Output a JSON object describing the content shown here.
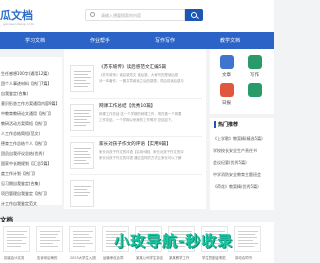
{
  "header": {
    "logo": "瓜文档",
    "logo_sub": "ganwendang.com",
    "search_placeholder": "请输入想要搜索的内容"
  },
  "nav": {
    "items": [
      "学习文档",
      "作业帮手",
      "写作写作",
      "教学文档"
    ]
  },
  "left_list": {
    "items": [
      "生任感想100字(通用12篇)",
      "团个人事迹材料【热门7篇】",
      "自我鉴定(合集)",
      "意识形态工作方案通用内容9篇】",
      "中教育教研论文通用【热门】",
      "教研活动方案简短【热门】",
      "人工作总结简短(范文)",
      "德育工作总结个人【热门】",
      "团员自我评议总结(优秀)",
      "国家中长期规划【汇总5篇】",
      "度工作计划【热门】",
      "见习期自我鉴定(合集)",
      "项目管理自我鉴定【热门】",
      "计工作自我鉴定范文"
    ]
  },
  "feed": {
    "items": [
      {
        "title": "《苏东坡传》读后感范文汇编5篇",
        "desc": [
          "《苏东坡传》读后感范文   读后感，大家写的是读后感",
          "对一本著作、一篇文章阅读之后的感想，然后将读后感与"
        ]
      },
      {
        "title": "网课工作总结【优秀10篇】",
        "desc": [
          "网课工作总结   这一个学期的网课工作，现在做一个简要",
          "工作总结，一个学期以来我的工作情况   总结如下。"
        ]
      },
      {
        "title": "家长对孩子作文的评语【实用9篇】",
        "desc": [
          "家长对孩子作文的评语【实用9篇】   家长对孩子作文的评",
          "家长对孩子作文的评语   通过这样的方式让家长可以了解"
        ]
      },
      {
        "title": "",
        "desc": []
      }
    ]
  },
  "right_panel": {
    "items": [
      {
        "label": "文章",
        "color": "#3f74cf"
      },
      {
        "label": "写作",
        "color": "#2b9a6a"
      },
      {
        "label": "日报",
        "color": "#e0573e"
      },
      {
        "label": "",
        "color": "#2b9a6a"
      }
    ],
    "row2": [
      {
        "label": "合同",
        "color": "#e8a13a"
      },
      {
        "label": "归档",
        "color": "#3f74cf"
      }
    ]
  },
  "hot": {
    "title": "热门推荐",
    "items": [
      "《上学歌》教案精(精选5篇)",
      "学校校长安全生产责任书",
      "会议纪要(优秀5篇)",
      "中学消防安全教育主题班会",
      "《荷花》教案精(优秀5篇)"
    ]
  },
  "section": {
    "title": "文档"
  },
  "docs": [
    "初级会计实务",
    "告诉你后悔的",
    "2023大学生入团",
    "运输承包合同",
    "某某公司学生协议",
    "某某教学工作",
    "学生贫困证明范",
    "劳动合同书"
  ],
  "watermark": "小玫导航-秒收录"
}
